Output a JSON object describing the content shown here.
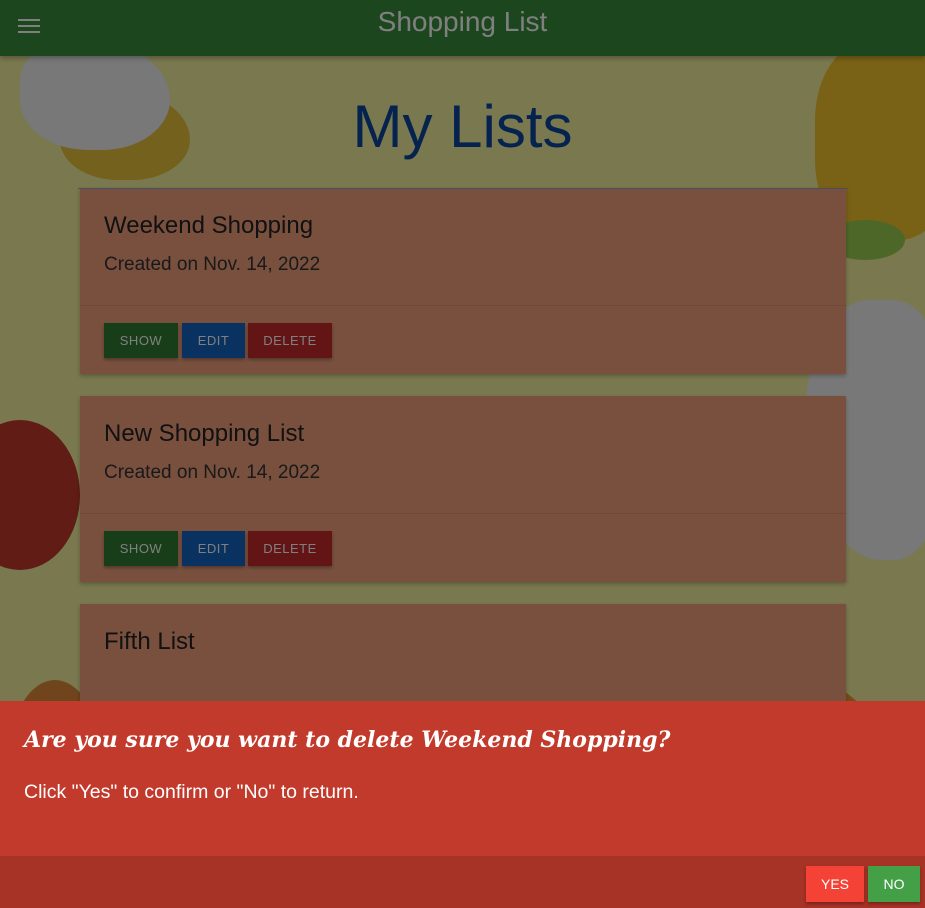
{
  "appbar": {
    "title": "Shopping List"
  },
  "page": {
    "title": "My Lists"
  },
  "lists": [
    {
      "name": "Weekend Shopping",
      "created": "Created on Nov. 14, 2022"
    },
    {
      "name": "New Shopping List",
      "created": "Created on Nov. 14, 2022"
    },
    {
      "name": "Fifth List",
      "created": ""
    }
  ],
  "actions": {
    "show": "SHOW",
    "edit": "EDIT",
    "delete": "DELETE"
  },
  "modal": {
    "heading": "Are you sure you want to delete Weekend Shopping?",
    "text": "Click \"Yes\" to confirm or \"No\" to return.",
    "yes": "YES",
    "no": "NO"
  }
}
